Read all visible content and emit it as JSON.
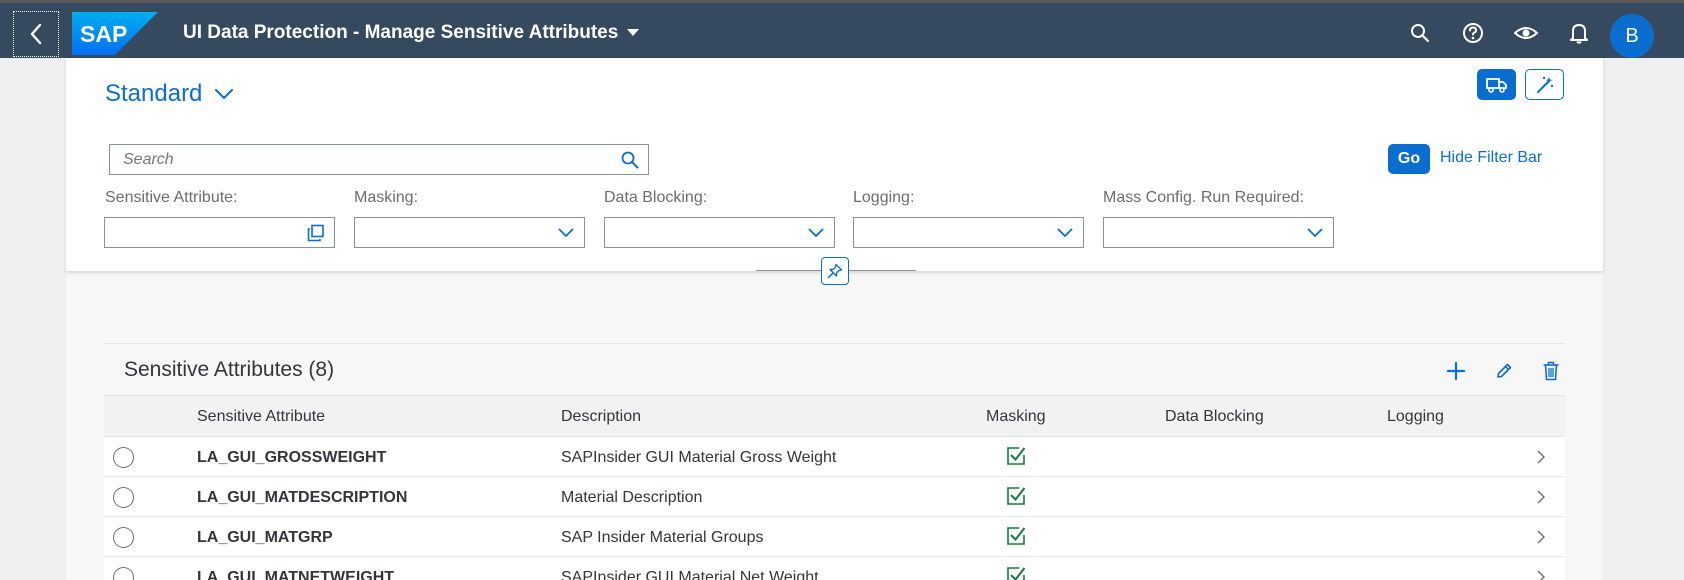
{
  "shell": {
    "logo_text": "SAP",
    "title": "UI Data Protection - Manage Sensitive Attributes",
    "avatar_initial": "B",
    "icons": [
      "back-icon",
      "search-icon",
      "help-icon",
      "eye-icon",
      "bell-icon"
    ]
  },
  "header": {
    "variant": "Standard",
    "search_placeholder": "Search",
    "go_label": "Go",
    "hide_filter_label": "Hide Filter Bar",
    "filters": [
      {
        "label": "Sensitive Attribute:",
        "value": ""
      },
      {
        "label": "Masking:",
        "value": ""
      },
      {
        "label": "Data Blocking:",
        "value": ""
      },
      {
        "label": "Logging:",
        "value": ""
      },
      {
        "label": "Mass Config. Run Required:",
        "value": ""
      }
    ]
  },
  "table": {
    "title": "Sensitive Attributes (8)",
    "columns": [
      "Sensitive Attribute",
      "Description",
      "Masking",
      "Data Blocking",
      "Logging"
    ],
    "rows": [
      {
        "attribute": "LA_GUI_GROSSWEIGHT",
        "description": "SAPInsider GUI Material Gross Weight",
        "masking": true,
        "data_blocking": false,
        "logging": false
      },
      {
        "attribute": "LA_GUI_MATDESCRIPTION",
        "description": "Material Description",
        "masking": true,
        "data_blocking": false,
        "logging": false
      },
      {
        "attribute": "LA_GUI_MATGRP",
        "description": "SAP Insider Material Groups",
        "masking": true,
        "data_blocking": false,
        "logging": false
      },
      {
        "attribute": "LA_GUI_MATNETWEIGHT",
        "description": "SAPInsider GUI Material Net Weight",
        "masking": true,
        "data_blocking": false,
        "logging": false
      }
    ]
  },
  "colors": {
    "shell_bg": "#354a5f",
    "accent": "#0a6ed1",
    "check_green": "#107e3e"
  }
}
